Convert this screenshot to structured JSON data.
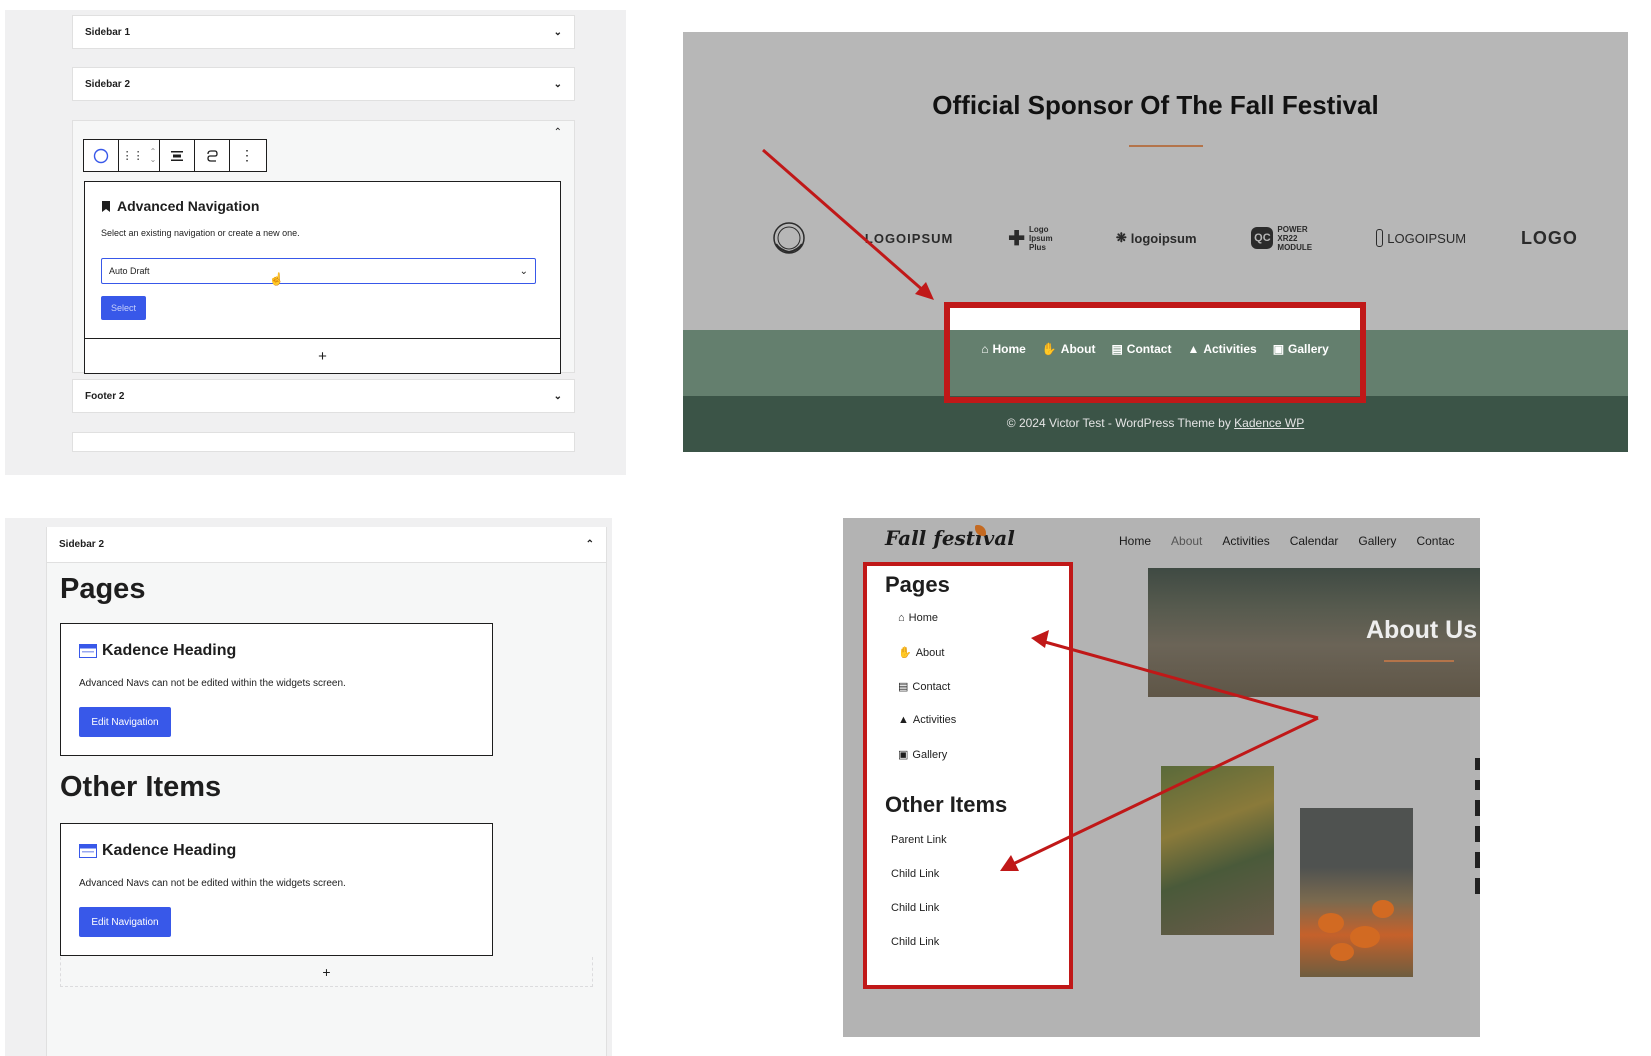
{
  "panel_widgets": {
    "sidebar1_label": "Sidebar 1",
    "sidebar2_label": "Sidebar 2",
    "footer2_label": "Footer 2",
    "block_title": "Advanced Navigation",
    "block_desc": "Select an existing navigation or create a new one.",
    "select_value": "Auto Draft",
    "select_button": "Select",
    "add_block": "+"
  },
  "panel_site_footer": {
    "title": "Official Sponsor Of The Fall Festival",
    "logos": [
      "LOGOIPSUM",
      "Logo Ipsum Plus",
      "logoipsum",
      "POWER XR22 MODULE",
      "LOGOIPSUM",
      "LOGO"
    ],
    "nav": [
      {
        "label": "Home",
        "icon": "house-icon"
      },
      {
        "label": "About",
        "icon": "hand-icon"
      },
      {
        "label": "Contact",
        "icon": "contact-card-icon"
      },
      {
        "label": "Activities",
        "icon": "tent-icon"
      },
      {
        "label": "Gallery",
        "icon": "image-icon"
      }
    ],
    "copyright_prefix": "© 2024 Victor Test - WordPress Theme by ",
    "copyright_link": "Kadence WP"
  },
  "panel_sidebar_editor": {
    "header_label": "Sidebar 2",
    "heading1": "Pages",
    "heading2": "Other Items",
    "kadence_title": "Kadence Heading",
    "kadence_desc": "Advanced Navs can not be edited within the widgets screen.",
    "edit_button": "Edit Navigation",
    "add_block": "+"
  },
  "panel_frontend": {
    "logo_text": "Fall festival",
    "nav": [
      "Home",
      "About",
      "Activities",
      "Calendar",
      "Gallery",
      "Contac"
    ],
    "hero_title": "About Us",
    "pages_heading": "Pages",
    "pages_items": [
      "Home",
      "About",
      "Contact",
      "Activities",
      "Gallery"
    ],
    "other_heading": "Other Items",
    "other_items": [
      "Parent Link",
      "Child Link",
      "Child Link",
      "Child Link"
    ]
  },
  "colors": {
    "wp_blue": "#3858e9",
    "highlight_red": "#c01818",
    "footer_green": "#647f6e",
    "footer_dark": "#3b5447",
    "accent_copper": "#b4744a"
  }
}
